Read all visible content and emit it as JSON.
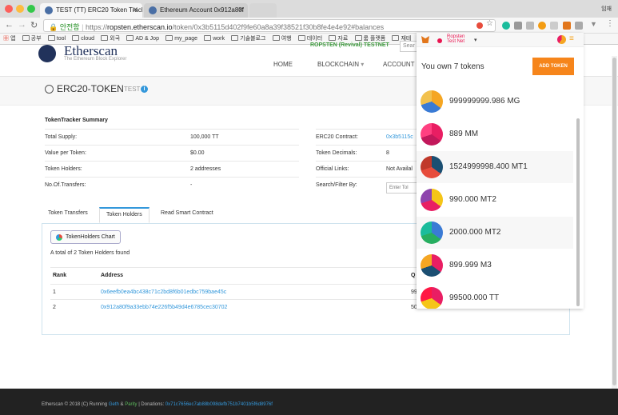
{
  "browser": {
    "corner_label": "임재",
    "tabs": [
      {
        "title": "TEST (TT) ERC20 Token Track"
      },
      {
        "title": "Ethereum Account 0x912a80f"
      }
    ],
    "security_label": "안전함",
    "url_scheme": "https://",
    "url_host": "ropsten.etherscan.io",
    "url_path": "/token/0x3b5115d402f9fe60a8a39f38521f30b8fe4e4e92#balances",
    "bookmarks": [
      "앱",
      "공부",
      "tool",
      "cloud",
      "외국",
      "AD & Jop",
      "my_page",
      "work",
      "기술블로그",
      "여행",
      "데이터",
      "자료",
      "룸 플랫폼",
      "재테"
    ]
  },
  "site": {
    "logo_text": "Etherscan",
    "logo_sub": "The Ethereum Block Explorer",
    "network": "ROPSTEN (Revival) TESTNET",
    "search_placeholder": "Sear",
    "nav": [
      "HOME",
      "BLOCKCHAIN",
      "ACCOUNT"
    ]
  },
  "page": {
    "title": "ERC20-TOKEN",
    "subtitle": "TEST",
    "summary_title": "TokenTracker Summary",
    "left_rows": [
      {
        "k": "Total Supply:",
        "v": "100,000 TT"
      },
      {
        "k": "Value per Token:",
        "v": "$0.00"
      },
      {
        "k": "Token Holders:",
        "v": "2 addresses"
      },
      {
        "k": "No.Of.Transfers:",
        "v": "-"
      }
    ],
    "right_rows": [
      {
        "k": "ERC20 Contract:",
        "v": "0x3b5115c"
      },
      {
        "k": "Token Decimals:",
        "v": "8"
      },
      {
        "k": "Official Links:",
        "v": "Not Availal"
      },
      {
        "k": "Search/Filter By:",
        "v": ""
      }
    ],
    "filter_placeholder": "Enter Tol",
    "tabs": [
      "Token Transfers",
      "Token Holders",
      "Read Smart Contract"
    ],
    "chart_button": "TokenHolders Chart",
    "holders_found": "A total of 2 Token Holders found",
    "table_headers": [
      "Rank",
      "Address",
      "Q"
    ],
    "holders": [
      {
        "rank": "1",
        "address": "0x6eefb0ea4bc438c71c2bd8f6b01edbc759bae45c",
        "q": "99"
      },
      {
        "rank": "2",
        "address": "0x912a80f9a33ebb74e226f5b49d4e6785cec30702",
        "q": "50"
      }
    ]
  },
  "footer": {
    "prefix": "Etherscan © 2018 (C) Running",
    "geth": "Geth",
    "amp": "&",
    "parity": "Parity",
    "donations_label": "| Donations:",
    "donation_addr": "0x71c7656ec7ab88b098defb751b7401b5f6d8976f"
  },
  "metamask": {
    "network_line1": "Ropsten",
    "network_line2": "Test Net",
    "own_text": "You own 7 tokens",
    "add_token": "ADD TOKEN",
    "tokens": [
      {
        "amount": "999999999.986 MG",
        "colors": [
          "#f5a623",
          "#3a7bd5",
          "#f2c14e"
        ]
      },
      {
        "amount": "889 MM",
        "colors": [
          "#e91e63",
          "#c2185b",
          "#ff4081"
        ]
      },
      {
        "amount": "1524999998.400 MT1",
        "colors": [
          "#1b4f72",
          "#e74c3c",
          "#c0392b"
        ]
      },
      {
        "amount": "990.000 MT2",
        "colors": [
          "#f5c518",
          "#e91e63",
          "#8e44ad"
        ]
      },
      {
        "amount": "2000.000 MT2",
        "colors": [
          "#3a7bd5",
          "#27ae60",
          "#1abc9c"
        ]
      },
      {
        "amount": "899.999 M3",
        "colors": [
          "#e91e63",
          "#1b4f72",
          "#f5a623"
        ]
      },
      {
        "amount": "99500.000 TT",
        "colors": [
          "#e91e63",
          "#f5c518",
          "#ff1744"
        ]
      }
    ]
  }
}
